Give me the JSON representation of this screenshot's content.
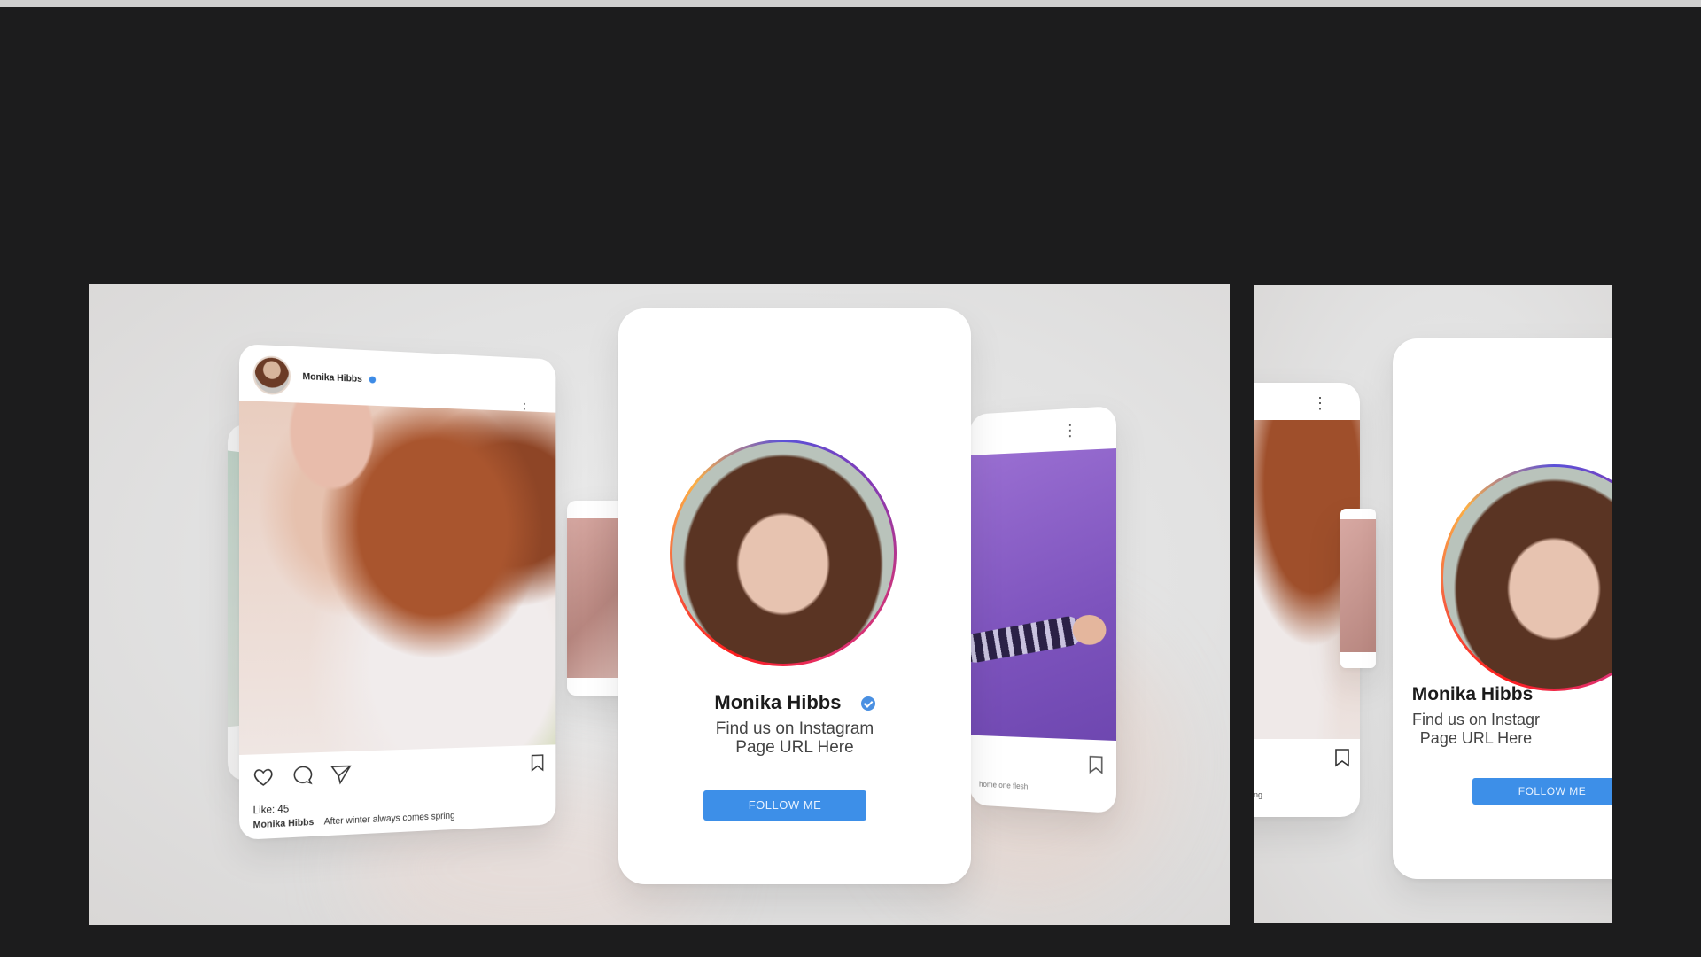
{
  "profile": {
    "name": "Monika Hibbs",
    "line1": "Find us on Instagram",
    "line2": "Page URL Here",
    "follow_label": "FOLLOW ME"
  },
  "post": {
    "username": "Monika Hibbs",
    "likes": "Like: 45",
    "caption_user": "Monika Hibbs",
    "caption_text": "After winter always comes spring",
    "right_card_caption": "home one flesh"
  },
  "side_frame": {
    "name": "Monika Hibbs",
    "line1": "Find us on Instagr",
    "line2": "Page URL Here",
    "follow_label": "FOLLOW ME",
    "caption_fragment": "ing"
  },
  "icons": [
    "heart-icon",
    "comment-icon",
    "send-icon",
    "bookmark-icon",
    "more-dots-icon",
    "verified-badge-icon"
  ],
  "colors": {
    "background": "#1c1c1d",
    "follow_button": "#3d8fe8",
    "verified": "#3d8be6",
    "purple_photo": "#8a5fc8"
  }
}
